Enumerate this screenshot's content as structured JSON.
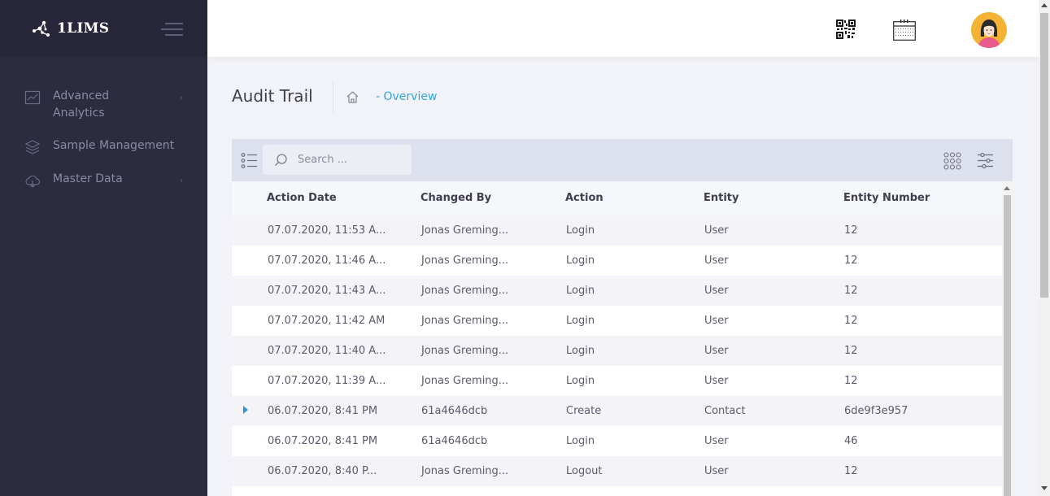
{
  "app": {
    "brand_name": "1LIMS"
  },
  "sidebar": {
    "items": [
      {
        "label": "Advanced Analytics",
        "icon": "chart-icon",
        "has_children": true
      },
      {
        "label": "Sample Management",
        "icon": "layers-icon",
        "has_children": false
      },
      {
        "label": "Master Data",
        "icon": "cloud-icon",
        "has_children": true
      }
    ],
    "arrow": "›"
  },
  "topbar": {
    "qr_icon": "qr-code-icon",
    "calendar_icon": "calendar-icon",
    "avatar_icon": "user-avatar"
  },
  "page": {
    "title": "Audit Trail",
    "breadcrumb": "- Overview"
  },
  "grid": {
    "search_placeholder": "Search ...",
    "columns": [
      "Action Date",
      "Changed By",
      "Action",
      "Entity",
      "Entity Number"
    ],
    "rows": [
      [
        "07.07.2020, 11:53 A...",
        "Jonas Greming...",
        "Login",
        "User",
        "12"
      ],
      [
        "07.07.2020, 11:46 A...",
        "Jonas Greming...",
        "Login",
        "User",
        "12"
      ],
      [
        "07.07.2020, 11:43 A...",
        "Jonas Greming...",
        "Login",
        "User",
        "12"
      ],
      [
        "07.07.2020, 11:42 AM",
        "Jonas Greming...",
        "Login",
        "User",
        "12"
      ],
      [
        "07.07.2020, 11:40 A...",
        "Jonas Greming...",
        "Login",
        "User",
        "12"
      ],
      [
        "07.07.2020, 11:39 A...",
        "Jonas Greming...",
        "Login",
        "User",
        "12"
      ],
      [
        "06.07.2020, 8:41 PM",
        "61a4646dcb",
        "Create",
        "Contact",
        "6de9f3e957"
      ],
      [
        "06.07.2020, 8:41 PM",
        "61a4646dcb",
        "Login",
        "User",
        "46"
      ],
      [
        "06.07.2020, 8:40 P...",
        "Jonas Greming...",
        "Logout",
        "User",
        "12"
      ]
    ],
    "expandable_row_index": 6
  },
  "colors": {
    "sidebar_bg": "#2c2b3f",
    "accent": "#30a7d9",
    "toolbar_bg": "#dde1ee"
  }
}
